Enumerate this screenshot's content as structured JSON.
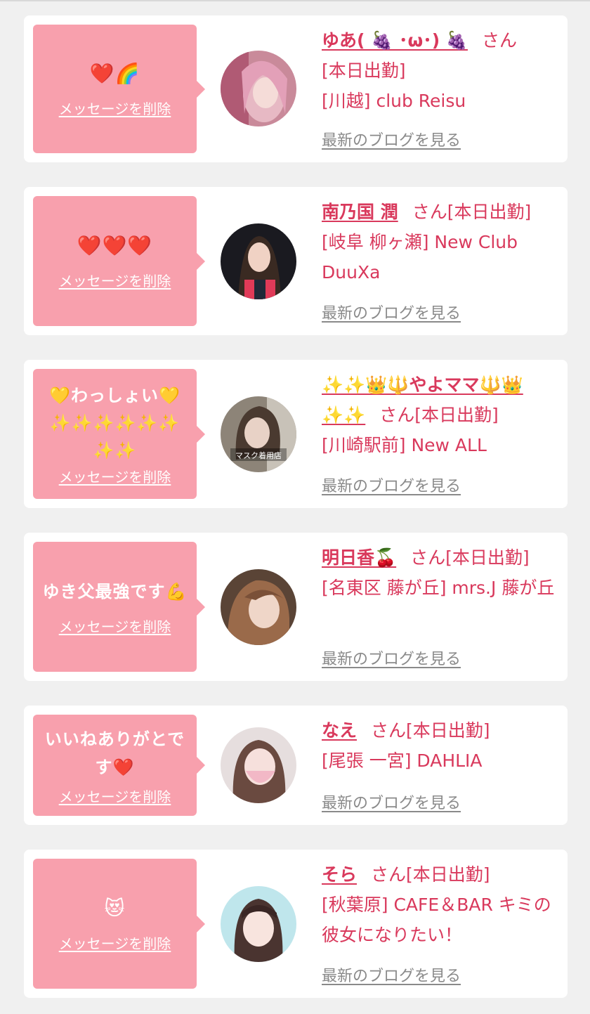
{
  "common": {
    "delete_label": "メッセージを削除",
    "blog_label": "最新のブログを見る"
  },
  "colors": {
    "bubble": "#f8a0ad",
    "accent": "#d9395c",
    "link_gray": "#8a8a8a",
    "background": "#f0f0f0"
  },
  "cards": [
    {
      "message": "❤️🌈",
      "name": "ゆあ( 🍇 ･ω･) 🍇",
      "san": "さん",
      "status": "[本日出勤]",
      "shop": "[川越] club Reisu",
      "avatar_icon": "girl-photo-pink-hair"
    },
    {
      "message": "❤️❤️❤️",
      "name": "南乃国 潤",
      "san": "さん",
      "status": "[本日出勤]",
      "shop": "[岐阜 柳ヶ瀬] New Club DuuXa",
      "avatar_icon": "girl-photo-dark-hair"
    },
    {
      "message": "💛わっしょい💛✨✨✨✨✨✨✨✨",
      "name": "✨✨👑🔱やよママ🔱👑✨✨",
      "san": "さん",
      "status": "[本日出勤]",
      "shop": "[川崎駅前] New ALL",
      "avatar_icon": "girl-photo-mask"
    },
    {
      "message": "ゆき父最強です💪",
      "name": "明日香🍒",
      "san": "さん",
      "status": "[本日出勤]",
      "shop": "[名東区 藤が丘] mrs.J 藤が丘",
      "avatar_icon": "girl-photo-brown-hair"
    },
    {
      "message": "いいねありがとです❤️",
      "name": "なえ",
      "san": "さん",
      "status": "[本日出勤]",
      "shop": "[尾張 一宮] DAHLIA",
      "avatar_icon": "girl-photo-light"
    },
    {
      "message": "😻",
      "name": "そら",
      "san": "さん",
      "status": "[本日出勤]",
      "shop": "[秋葉原] CAFE＆BAR キミの彼女になりたい！",
      "avatar_icon": "girl-photo-bob"
    }
  ]
}
